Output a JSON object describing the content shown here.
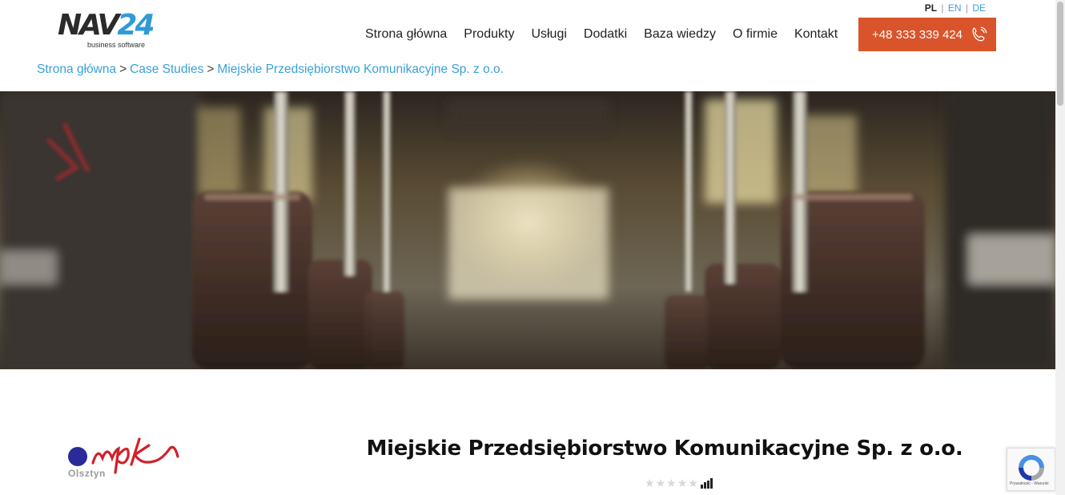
{
  "brand": {
    "logo_main": "NAV",
    "logo_number": "24",
    "tagline": "business software"
  },
  "languages": {
    "active": "PL",
    "others": [
      "EN",
      "DE"
    ],
    "separator": "|"
  },
  "nav": {
    "items": [
      "Strona główna",
      "Produkty",
      "Usługi",
      "Dodatki",
      "Baza wiedzy",
      "O firmie",
      "Kontakt"
    ]
  },
  "phone": {
    "label": "+48 333 339 424",
    "icon": "phone-icon"
  },
  "breadcrumb": {
    "items": [
      "Strona główna",
      "Case Studies",
      "Miejskie Przedsiębiorstwo Komunikacyjne Sp. z o.o."
    ],
    "separator": ">"
  },
  "hero": {
    "description": "Blurred bus interior"
  },
  "client": {
    "logo_text": "mpk",
    "logo_city": "Olsztyn",
    "name": "Miejskie Przedsiębiorstwo Komunikacyjne Sp. z o.o.",
    "rating_stars": 5,
    "rating_value": 0
  },
  "recaptcha": {
    "footer": "Prywatność - Warunki"
  },
  "colors": {
    "accent": "#d9542b",
    "link": "#3aa0d8",
    "logo_blue": "#2f9ad6"
  }
}
